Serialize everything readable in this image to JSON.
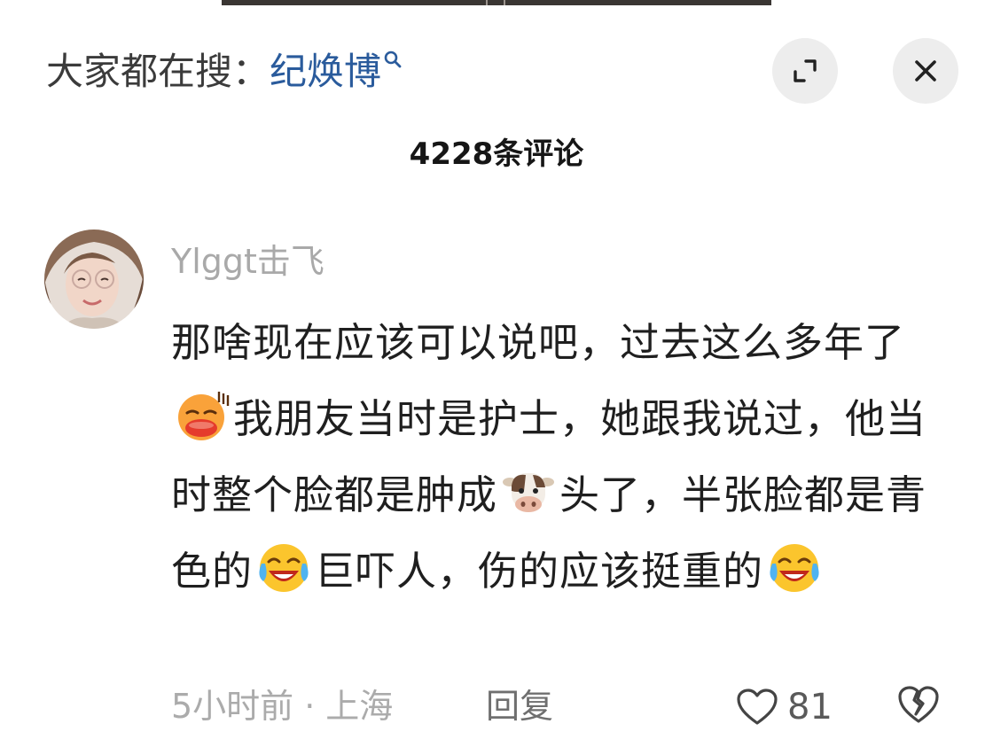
{
  "search": {
    "prefix": "大家都在搜：",
    "term": "纪焕博",
    "icon": "search-icon"
  },
  "header": {
    "expand_icon": "expand-icon",
    "close_icon": "close-icon",
    "comment_count": "4228条评论"
  },
  "comment": {
    "username": "Ylggt击飞",
    "body_parts": {
      "p1": "那啥现在应该可以说吧，过去这么多年了",
      "p2": "我朋友当时是护士，她跟我说过，他当时整个脸都是肿成",
      "p3": "头了，半张脸都是青色的",
      "p4": "巨吓人，伤的应该挺重的"
    },
    "emojis": [
      "sweat-smile-emoji",
      "cow-face-emoji",
      "crying-laugh-emoji",
      "crying-laugh-emoji"
    ],
    "time": "5小时前",
    "separator": "·",
    "location": "上海",
    "reply_label": "回复",
    "like_count": "81"
  },
  "colors": {
    "search_term": "#2a5b9c",
    "username": "#a9a9a9",
    "button_bg": "#ededed"
  }
}
